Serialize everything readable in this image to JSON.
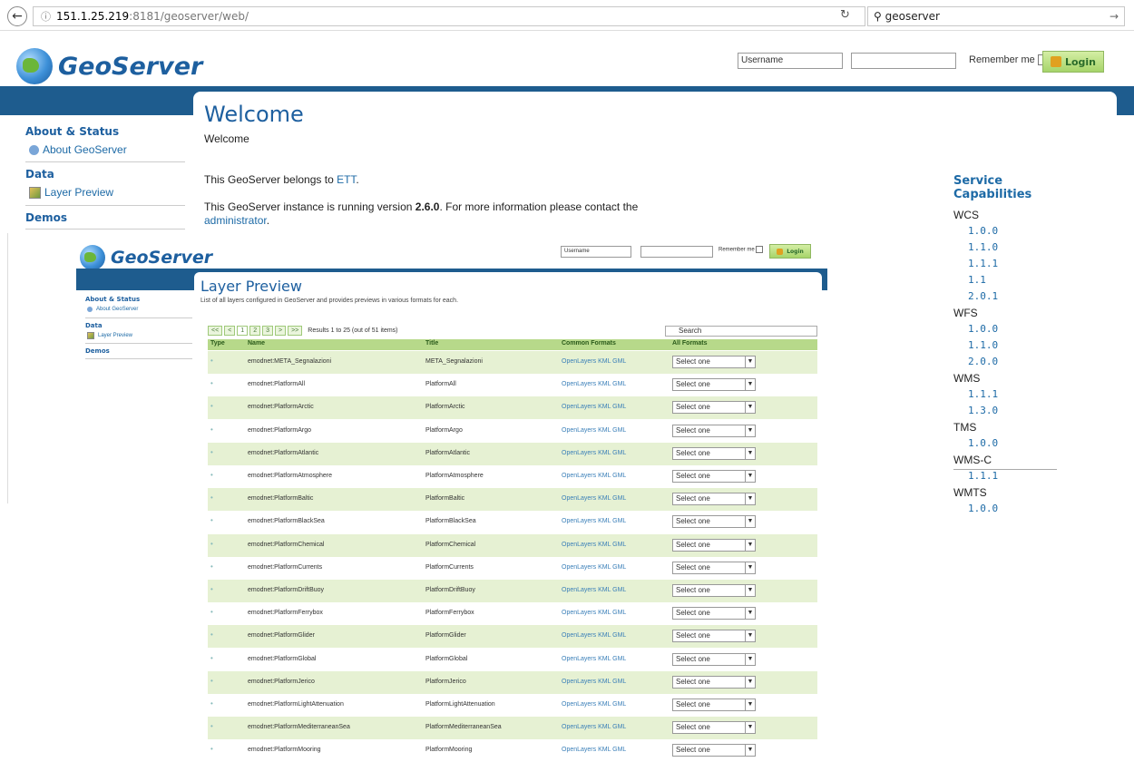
{
  "browser": {
    "url_host": "151.1.25.219",
    "url_rest": ":8181/geoserver/web/",
    "search_value": "geoserver"
  },
  "header": {
    "logo_text": "GeoServer",
    "username_placeholder": "Username",
    "remember_label": "Remember me",
    "login_label": "Login"
  },
  "sidebar": {
    "about_status": "About & Status",
    "about_geoserver": "About GeoServer",
    "data": "Data",
    "layer_preview": "Layer Preview",
    "demos": "Demos"
  },
  "welcome": {
    "title": "Welcome",
    "subtitle": "Welcome",
    "belongs_prefix": "This GeoServer belongs to ",
    "belongs_link": "ETT",
    "belongs_suffix": ".",
    "version_prefix": "This GeoServer instance is running version ",
    "version": "2.6.0",
    "version_suffix": ". For more information please contact the",
    "admin_link": "administrator",
    "admin_suffix": "."
  },
  "capabilities": {
    "title": "Service Capabilities",
    "services": [
      {
        "name": "WCS",
        "versions": [
          "1.0.0",
          "1.1.0",
          "1.1.1",
          "1.1",
          "2.0.1"
        ]
      },
      {
        "name": "WFS",
        "versions": [
          "1.0.0",
          "1.1.0",
          "2.0.0"
        ]
      },
      {
        "name": "WMS",
        "versions": [
          "1.1.1",
          "1.3.0"
        ]
      },
      {
        "name": "TMS",
        "versions": [
          "1.0.0"
        ]
      },
      {
        "name": "WMS-C",
        "versions": [
          "1.1.1"
        ]
      },
      {
        "name": "WMTS",
        "versions": [
          "1.0.0"
        ]
      }
    ]
  },
  "layer_preview": {
    "title": "Layer Preview",
    "description": "List of all layers configured in GeoServer and provides previews in various formats for each.",
    "pager": [
      "<<",
      "<",
      "1",
      "2",
      "3",
      ">",
      ">>"
    ],
    "results": "Results 1 to 25 (out of 51 items)",
    "search_placeholder": "Search",
    "columns": [
      "Type",
      "Name",
      "Title",
      "Common Formats",
      "All Formats"
    ],
    "common_formats": "OpenLayers KML GML",
    "select_label": "Select one",
    "rows": [
      {
        "name": "emodnet:META_Segnalazioni",
        "title": "META_Segnalazioni"
      },
      {
        "name": "emodnet:PlatformAll",
        "title": "PlatformAll"
      },
      {
        "name": "emodnet:PlatformArctic",
        "title": "PlatformArctic"
      },
      {
        "name": "emodnet:PlatformArgo",
        "title": "PlatformArgo"
      },
      {
        "name": "emodnet:PlatformAtlantic",
        "title": "PlatformAtlantic"
      },
      {
        "name": "emodnet:PlatformAtmosphere",
        "title": "PlatformAtmosphere"
      },
      {
        "name": "emodnet:PlatformBaltic",
        "title": "PlatformBaltic"
      },
      {
        "name": "emodnet:PlatformBlackSea",
        "title": "PlatformBlackSea"
      },
      {
        "name": "emodnet:PlatformChemical",
        "title": "PlatformChemical"
      },
      {
        "name": "emodnet:PlatformCurrents",
        "title": "PlatformCurrents"
      },
      {
        "name": "emodnet:PlatformDriftBuoy",
        "title": "PlatformDriftBuoy"
      },
      {
        "name": "emodnet:PlatformFerrybox",
        "title": "PlatformFerrybox"
      },
      {
        "name": "emodnet:PlatformGlider",
        "title": "PlatformGlider"
      },
      {
        "name": "emodnet:PlatformGlobal",
        "title": "PlatformGlobal"
      },
      {
        "name": "emodnet:PlatformJerico",
        "title": "PlatformJerico"
      },
      {
        "name": "emodnet:PlatformLightAttenuation",
        "title": "PlatformLightAttenuation"
      },
      {
        "name": "emodnet:PlatformMediterraneanSea",
        "title": "PlatformMediterraneanSea"
      },
      {
        "name": "emodnet:PlatformMooring",
        "title": "PlatformMooring"
      }
    ]
  }
}
